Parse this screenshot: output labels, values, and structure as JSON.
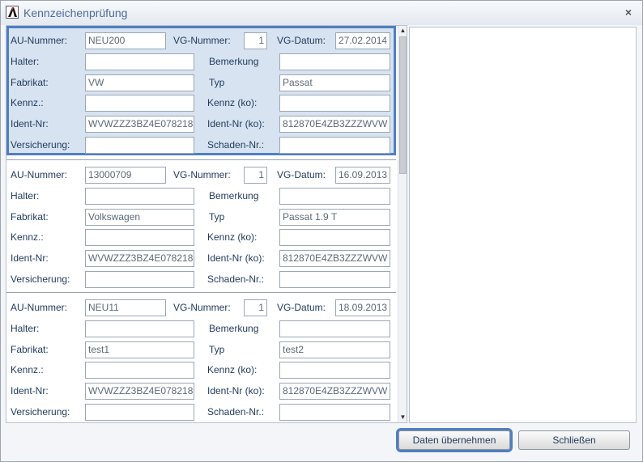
{
  "window": {
    "title": "Kennzeichenprüfung",
    "close_symbol": "×"
  },
  "labels": {
    "au": "AU-Nummer:",
    "vg_nr": "VG-Nummer:",
    "vg_datum": "VG-Datum:",
    "halter": "Halter:",
    "bemerkung": "Bemerkung",
    "fabrikat": "Fabrikat:",
    "typ": "Typ",
    "kennz": "Kennz.:",
    "kennz_ko": "Kennz (ko):",
    "ident": "Ident-Nr:",
    "ident_ko": "Ident-Nr (ko):",
    "versicherung": "Versicherung:",
    "schaden": "Schaden-Nr.:"
  },
  "records": [
    {
      "au": "NEU200",
      "vg_nr": "1",
      "vg_datum": "27.02.2014",
      "halter": "",
      "bemerkung": "",
      "fabrikat": "VW",
      "typ": "Passat",
      "kennz": "",
      "kennz_ko": "",
      "ident": "WVWZZZ3BZ4E078218",
      "ident_ko": "812870E4ZB3ZZZWVW",
      "versicherung": "",
      "schaden": ""
    },
    {
      "au": "13000709",
      "vg_nr": "1",
      "vg_datum": "16.09.2013",
      "halter": "",
      "bemerkung": "",
      "fabrikat": "Volkswagen",
      "typ": "Passat 1.9 T",
      "kennz": "",
      "kennz_ko": "",
      "ident": "WVWZZZ3BZ4E078218",
      "ident_ko": "812870E4ZB3ZZZWVW",
      "versicherung": "",
      "schaden": ""
    },
    {
      "au": "NEU11",
      "vg_nr": "1",
      "vg_datum": "18.09.2013",
      "halter": "",
      "bemerkung": "",
      "fabrikat": "test1",
      "typ": "test2",
      "kennz": "",
      "kennz_ko": "",
      "ident": "WVWZZZ3BZ4E078218",
      "ident_ko": "812870E4ZB3ZZZWVW",
      "versicherung": "",
      "schaden": ""
    }
  ],
  "buttons": {
    "apply": "Daten übernehmen",
    "close": "Schließen"
  }
}
